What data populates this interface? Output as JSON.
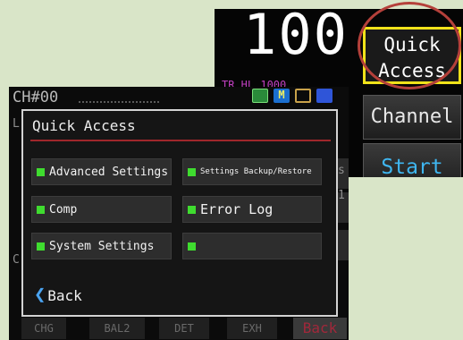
{
  "top_screen": {
    "big_value": "100",
    "hint_text": "TR HL    1000",
    "buttons": {
      "quick_access_line1": "Quick",
      "quick_access_line2": "Access",
      "channel": "Channel",
      "start": "Start"
    }
  },
  "main_screen": {
    "channel_title": "CH#00",
    "status_icons": [
      "monitor-icon",
      "m-icon",
      "lock-icon",
      "list-icon"
    ],
    "status_icon_m_text": "M",
    "ghost_letters": [
      "L",
      "C",
      "s",
      "1"
    ],
    "bottom_tabs": [
      "CHG",
      "BAL2",
      "DET",
      "EXH",
      "Back"
    ]
  },
  "dialog": {
    "title": "Quick Access",
    "buttons": [
      {
        "label": "Advanced Settings"
      },
      {
        "label": "Settings Backup/Restore"
      },
      {
        "label": "Comp"
      },
      {
        "label": "Error Log"
      },
      {
        "label": "System Settings"
      },
      {
        "label": ""
      }
    ],
    "back_label": "Back"
  },
  "colors": {
    "led_green": "#3fdc2f",
    "highlight_yellow": "#f0e21a",
    "divider_red": "#a0272b",
    "start_blue": "#3fb6f0",
    "ring_red": "#b4403a"
  }
}
